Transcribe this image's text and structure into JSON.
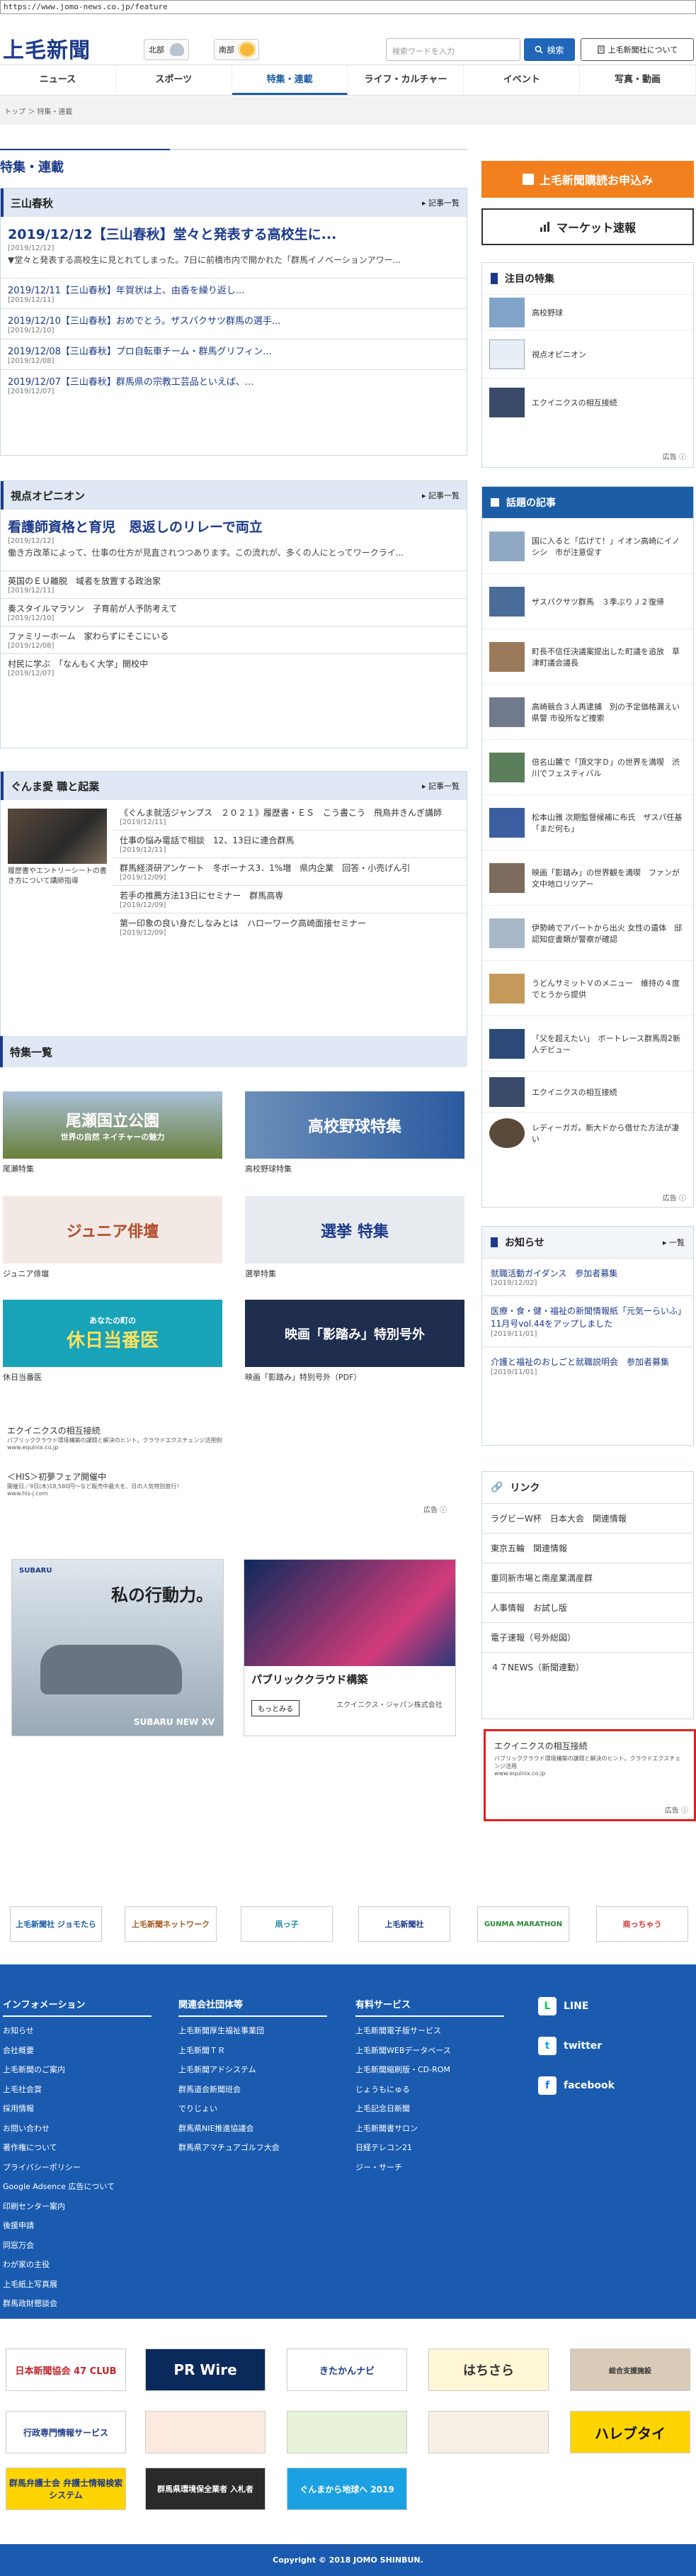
{
  "browser": {
    "url": "https://www.jomo-news.co.jp/feature"
  },
  "header": {
    "logo": "上毛新聞",
    "weather": [
      {
        "area": "北部",
        "icon": "cloud-icon"
      },
      {
        "area": "南部",
        "icon": "sun-icon"
      }
    ],
    "search_placeholder": "検索ワードを入力",
    "search_button": "検索",
    "about_button": "上毛新聞社について"
  },
  "nav": [
    {
      "label": "ニュース"
    },
    {
      "label": "スポーツ"
    },
    {
      "label": "特集・連載"
    },
    {
      "label": "ライフ・カルチャー"
    },
    {
      "label": "イベント"
    },
    {
      "label": "写真・動画"
    }
  ],
  "breadcrumb": {
    "home": "トップ",
    "sep": "＞",
    "current": "特集・連載"
  },
  "page_title": "特集・連載",
  "more_label": "記事一覧",
  "sanmo": {
    "title": "三山春秋",
    "lead": {
      "title": "2019/12/12【三山春秋】堂々と発表する高校生に...",
      "date": "[2019/12/12]",
      "summary": "▼堂々と発表する高校生に見とれてしまった。7日に前橋市内で開かれた「群馬イノベーションアワー..."
    },
    "items": [
      {
        "t": "2019/12/11【三山春秋】年賀状は上、由香を繰り返し...",
        "d": "[2019/12/11]"
      },
      {
        "t": "2019/12/10【三山春秋】おめでとう。ザスパクサツ群馬の選手...",
        "d": "[2019/12/10]"
      },
      {
        "t": "2019/12/08【三山春秋】プロ自転車チーム・群馬グリフィン...",
        "d": "[2019/12/08]"
      },
      {
        "t": "2019/12/07【三山春秋】群馬県の宗教工芸品といえば、...",
        "d": "[2019/12/07]"
      }
    ]
  },
  "opinion": {
    "title": "視点オピニオン",
    "lead": {
      "title": "看護師資格と育児　恩返しのリレーで両立",
      "date": "[2019/12/12]",
      "summary": "働き方改革によって、仕事の仕方が見直されつつあります。この流れが、多くの人にとってワークライ..."
    },
    "items": [
      {
        "t": "英国のＥＵ離脱　域者を放置する政治家",
        "d": "[2019/12/11]"
      },
      {
        "t": "奏スタイルマラソン　子育前が人予防考えて",
        "d": "[2019/12/10]"
      },
      {
        "t": "ファミリーホーム　家わらずにそこにいる",
        "d": "[2019/12/08]"
      },
      {
        "t": "村民に学ぶ　「なんもく大学」開校中",
        "d": "[2019/12/07]"
      }
    ]
  },
  "career": {
    "title": "ぐんま愛 職と起業",
    "caption": "履歴書やエントリーシートの書き方について講師指導",
    "items": [
      {
        "t": "《ぐんま就活ジャンプス　２０２１》履歴書・ＥＳ　こう書こう　飛鳥井きんぎ講師",
        "d": "[2019/12/11]"
      },
      {
        "t": "仕事の悩み電話で相談　12、13日に連合群馬",
        "d": "[2019/12/11]"
      },
      {
        "t": "群馬経済研アンケート　冬ボーナス3．1%増　県内企業　回答・小売げん引",
        "d": "[2019/12/09]"
      },
      {
        "t": "若手の推薦方法13日にセミナー　群馬高専",
        "d": "[2019/12/09]"
      },
      {
        "t": "第一印象の良い身だしなみとは　ハローワーク高崎面接セミナー",
        "d": "[2019/12/09]"
      }
    ]
  },
  "feature_list": {
    "title": "特集一覧",
    "items": [
      {
        "img": "尾瀬国立公園",
        "sub": "世界の自然 ネイチャーの魅力",
        "cap": "尾瀬特集",
        "bg": "#6a7f3a"
      },
      {
        "img": "高校野球特集",
        "sub": "",
        "cap": "高校野球特集",
        "bg": "#2b5aa0"
      },
      {
        "img": "ジュニア俳壇",
        "sub": "",
        "cap": "ジュニア俳壇",
        "bg": "#e8d6d0"
      },
      {
        "img": "選挙 特集",
        "sub": "",
        "cap": "選挙特集",
        "bg": "#dfe4ea"
      },
      {
        "img": "休日当番医",
        "sub": "あなたの町の",
        "cap": "休日当番医",
        "bg": "#19a3b8"
      },
      {
        "img": "映画「影踏み」特別号外",
        "sub": "",
        "cap": "映画「影踏み」特別号外（PDF）",
        "bg": "#1f2e4f"
      }
    ]
  },
  "ads_left": [
    {
      "t": "エクイニクスの相互接続",
      "s": "パブリッククラウド環境構築の課題と解決のヒント。クラウドエクスチェンジ活用例",
      "u": "www.equinix.co.jp"
    },
    {
      "t": "＜HIS＞初夢フェア開催中",
      "s": "開催日／9日(木)18,580円〜など販売中最大を、日の人気特別旅行！",
      "u": "www.his-j.com"
    }
  ],
  "ad_label": "広告",
  "big_ads": [
    {
      "t": "私の行動力。",
      "s": "SUBARU NEW XV"
    },
    {
      "t": "パブリッククラウド構築",
      "s": "もっとみる",
      "brand": "エクイニクス・ジャパン株式会社"
    }
  ],
  "right": {
    "apply": "上毛新聞購読お申込み",
    "market": "マーケット速報",
    "featured": {
      "title": "注目の特集",
      "items": [
        {
          "t": "高校野球"
        },
        {
          "t": "視点オピニオン"
        },
        {
          "t": "エクイニクスの相互接続"
        }
      ]
    },
    "topics": {
      "title": "話題の記事",
      "items": [
        {
          "t": "国に入ると「広げて！」イオン高崎にイノシシ　市が注意促す"
        },
        {
          "t": "ザスパクサツ群馬　３季ぶりＪ２復帰"
        },
        {
          "t": "町長不信任決議案提出した町議を追放　草津町議会議長"
        },
        {
          "t": "高崎競合３人再逮捕　別の予定価格漏えい　県警 市役所など捜索"
        },
        {
          "t": "倍名山麓で「頂文字Ｄ」の世界を満喫　渋川でフェスティバル"
        },
        {
          "t": "松本山雅 次期監督候補に布氏　ザスパ任基「まだ何も」"
        },
        {
          "t": "映画「影踏み」の世界観を満喫　ファンが文中地ロリツアー"
        },
        {
          "t": "伊勢崎でアパートから出火 女性の遺体　邸認知症書類が警察が確認"
        },
        {
          "t": "うどんサミットＶのメニュー　維持の４度でとうから提供"
        },
        {
          "t": "「父を超えたい」　ボートレース群馬周2新人デビュー"
        },
        {
          "t": "エクイニクスの相互接続"
        },
        {
          "t": "レディーガガ。新大ドから借せた方法が凄い"
        }
      ]
    },
    "notice": {
      "title": "お知らせ",
      "more": "一覧",
      "items": [
        {
          "t": "就職活動ガイダンス　参加者募集",
          "d": "[2019/12/02]"
        },
        {
          "t": "医療・食・健・福祉の新聞情報紙「元気ーらいふ」11月号vol.44をアップしました",
          "d": "[2019/11/01]"
        },
        {
          "t": "介護と福祉のおしごと就職説明会　参加者募集",
          "d": "[2019/11/01]"
        }
      ]
    },
    "links": {
      "title": "リンク",
      "items": [
        "ラグビーW杯　日本大会　関連情報",
        "東京五輪　関連情報",
        "重同新市場と南産業満産群",
        "人事情報　お試し版",
        "電子速報（号外総図）",
        "４７NEWS（新聞連動）"
      ]
    },
    "ad": {
      "t": "エクイニクスの相互接続",
      "s": "パブリッククラウド環境構築の課題と解決のヒント。クラウドエクスチェンジ活用",
      "u": "www.equinix.co.jp"
    }
  },
  "sponsor_banners": [
    "上毛新聞社 ジョモたら",
    "上毛新聞ネットワーク",
    "凧っ子",
    "上毛新聞社",
    "GUNMA MARATHON",
    "商っちゃう"
  ],
  "footer": {
    "info": {
      "title": "インフォメーション",
      "items": [
        "お知らせ",
        "会社概要",
        "上毛新聞のご案内",
        "上毛社会賞",
        "採用情報",
        "お問い合わせ",
        "著作権について",
        "プライバシーポリシー",
        "Google Adsence 広告について",
        "印刷センター案内",
        "後援申請",
        "同窓万会",
        "わが家の主役",
        "上毛紙上写真展",
        "群馬政財懇談会"
      ]
    },
    "groups": {
      "title": "関連会社団体等",
      "items": [
        "上毛新聞厚生福祉事業団",
        "上毛新聞ＴＲ",
        "上毛新聞アドシステム",
        "群馬道会新聞班会",
        "でりじょい",
        "群馬県NIE推進協議会",
        "群馬県アマチュアゴルフ大会"
      ]
    },
    "paid": {
      "title": "有料サービス",
      "items": [
        "上毛新聞電子版サービス",
        "上毛新聞WEBデータベース",
        "上毛新聞縮刷版・CD-ROM",
        "じょうもにゅる",
        "上毛記念日新聞",
        "上毛新聞書サロン",
        "日経テレコン21",
        "ジー・サーチ"
      ]
    },
    "social": [
      {
        "name": "LINE",
        "color": "#06c755",
        "glyph": "L"
      },
      {
        "name": "twitter",
        "color": "#1da1f2",
        "glyph": "t"
      },
      {
        "name": "facebook",
        "color": "#1877f2",
        "glyph": "f"
      }
    ]
  },
  "partner_banners": [
    "日本新聞協会 47 CLUB",
    "PR Wire",
    "きたかんナビ",
    "はちさら",
    "総合支援施設",
    "行政専門情報サービス",
    "",
    "",
    "",
    "",
    "群馬弁護士会 弁護士情報検索システム",
    "群馬県環境保全業者 入札者",
    "ぐんまから地球へ 2019",
    "ハレブタイ"
  ],
  "copyright": "Copyright © 2018 JOMO SHINBUN."
}
